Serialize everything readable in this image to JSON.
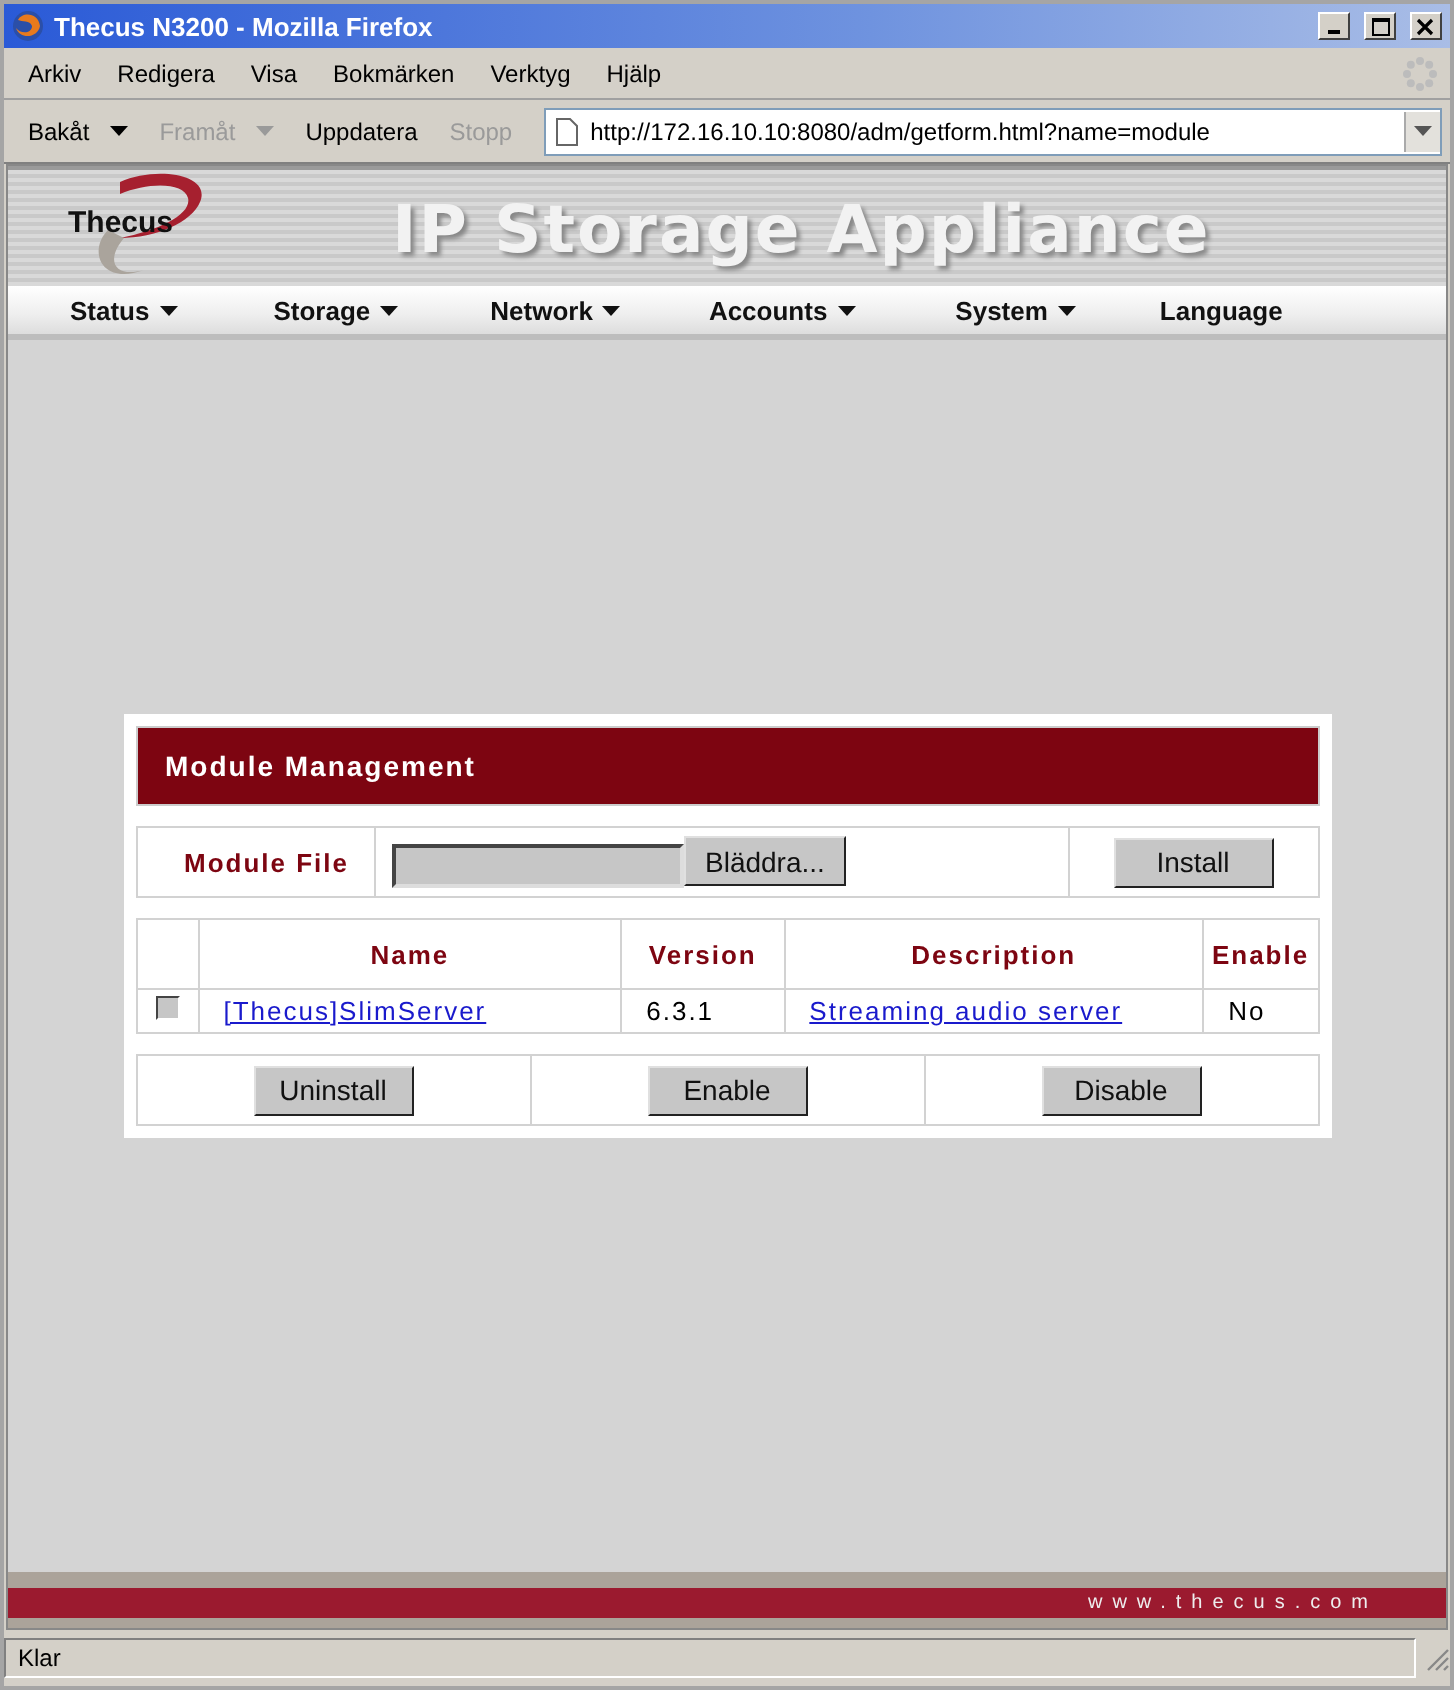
{
  "window": {
    "title": "Thecus N3200 - Mozilla Firefox"
  },
  "menu_bar": [
    "Arkiv",
    "Redigera",
    "Visa",
    "Bokmärken",
    "Verktyg",
    "Hjälp"
  ],
  "nav_toolbar": {
    "buttons": [
      {
        "label": "Bakåt",
        "disabled": false,
        "dropdown": true
      },
      {
        "label": "Framåt",
        "disabled": true,
        "dropdown": true
      },
      {
        "label": "Uppdatera",
        "disabled": false,
        "dropdown": false
      },
      {
        "label": "Stopp",
        "disabled": true,
        "dropdown": false
      }
    ],
    "address": "http://172.16.10.10:8080/adm/getform.html?name=module"
  },
  "header": {
    "logo": "Thecus",
    "title": "IP Storage Appliance"
  },
  "main_menu": [
    {
      "label": "Status",
      "dropdown": true
    },
    {
      "label": "Storage",
      "dropdown": true
    },
    {
      "label": "Network",
      "dropdown": true
    },
    {
      "label": "Accounts",
      "dropdown": true
    },
    {
      "label": "System",
      "dropdown": true
    },
    {
      "label": "Language",
      "dropdown": false
    }
  ],
  "panel": {
    "title": "Module Management",
    "file_label": "Module File",
    "browse_button": "Bläddra...",
    "install_button": "Install",
    "table": {
      "columns": [
        "Name",
        "Version",
        "Description",
        "Enable"
      ],
      "rows": [
        {
          "checked": false,
          "name": "[Thecus]SlimServer",
          "version": "6.3.1",
          "description": "Streaming audio server",
          "enable": "No"
        }
      ]
    },
    "actions": [
      "Uninstall",
      "Enable",
      "Disable"
    ]
  },
  "footer": {
    "url": "www.thecus.com"
  },
  "status_bar": {
    "text": "Klar"
  }
}
